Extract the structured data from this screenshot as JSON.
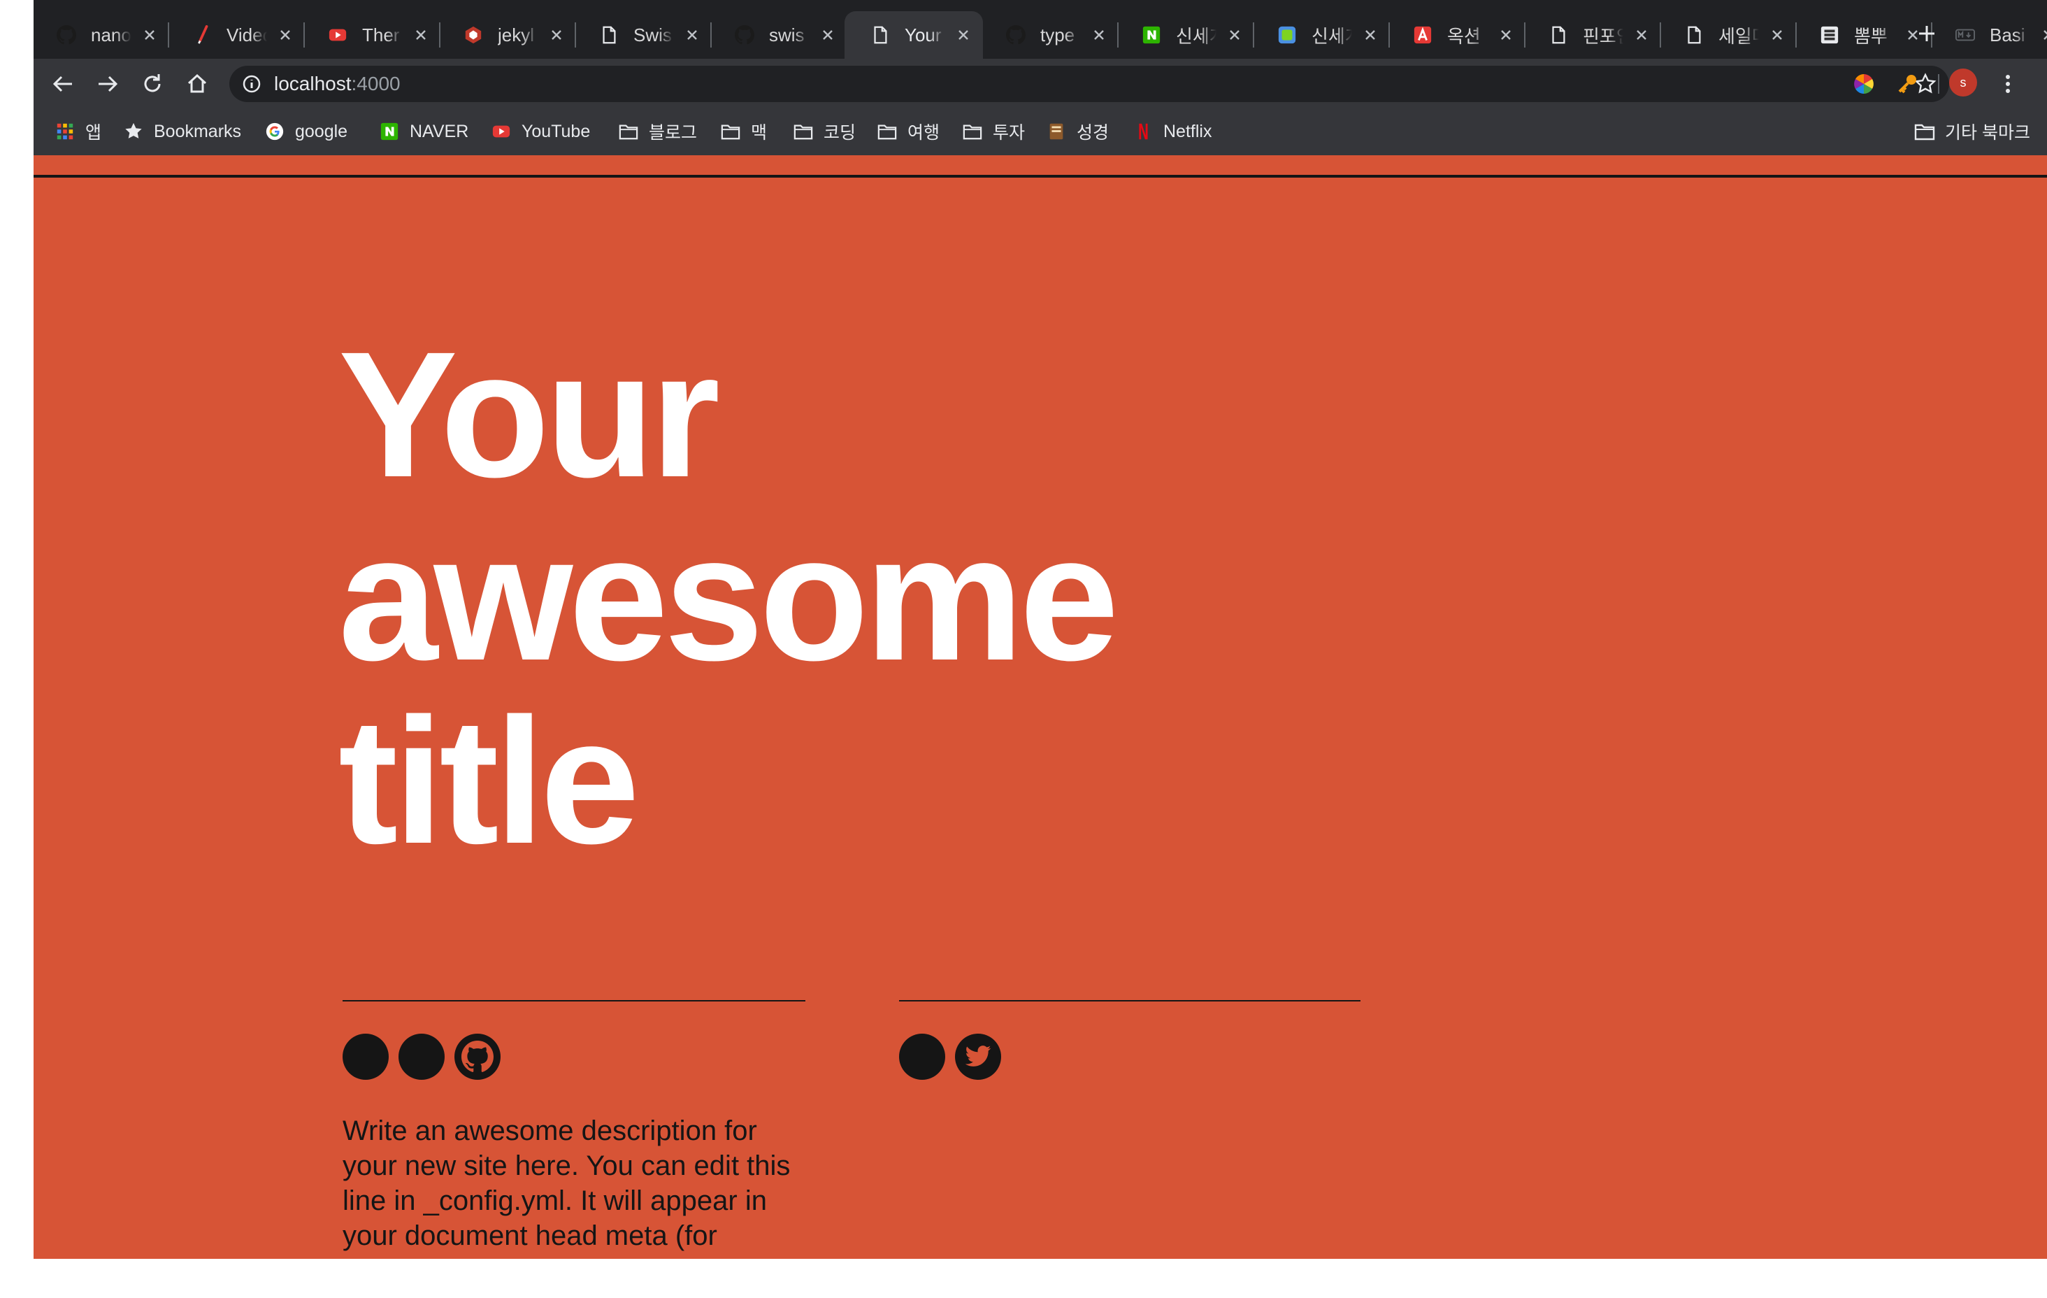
{
  "browser": {
    "tabs": [
      {
        "title": "nano",
        "icon": "github-icon"
      },
      {
        "title": "Video",
        "icon": "brush-icon"
      },
      {
        "title": "Ther",
        "icon": "youtube-icon"
      },
      {
        "title": "jekyl",
        "icon": "jekyll-icon"
      },
      {
        "title": "Swis",
        "icon": "document-icon"
      },
      {
        "title": "swis",
        "icon": "github-icon"
      },
      {
        "title": "Your",
        "icon": "document-icon",
        "active": true
      },
      {
        "title": "type",
        "icon": "github-icon"
      },
      {
        "title": "신세계",
        "icon": "naver-icon"
      },
      {
        "title": "신세계",
        "icon": "app-icon"
      },
      {
        "title": "옥션",
        "icon": "auction-icon"
      },
      {
        "title": "핀포인트",
        "icon": "document-icon"
      },
      {
        "title": "세일마",
        "icon": "document-icon"
      },
      {
        "title": "뽐뿌",
        "icon": "ppomppu-icon"
      },
      {
        "title": "Basi",
        "icon": "markdown-icon"
      }
    ],
    "address": {
      "host": "localhost",
      "port": ":4000"
    },
    "profile_initial": "s",
    "bookmarks": [
      {
        "label": "앱",
        "icon": "apps-grid-icon"
      },
      {
        "label": "Bookmarks",
        "icon": "star-icon"
      },
      {
        "label": "google",
        "icon": "google-icon"
      },
      {
        "label": "NAVER",
        "icon": "naver-icon"
      },
      {
        "label": "YouTube",
        "icon": "youtube-icon"
      },
      {
        "label": "블로그",
        "icon": "folder-icon"
      },
      {
        "label": "맥",
        "icon": "folder-icon"
      },
      {
        "label": "코딩",
        "icon": "folder-icon"
      },
      {
        "label": "여행",
        "icon": "folder-icon"
      },
      {
        "label": "투자",
        "icon": "folder-icon"
      },
      {
        "label": "성경",
        "icon": "bible-icon"
      },
      {
        "label": "Netflix",
        "icon": "netflix-icon"
      }
    ],
    "other_bookmarks": "기타 북마크"
  },
  "page": {
    "title_lines": [
      "Your",
      "awesome",
      "title"
    ],
    "description": "Write an awesome description for your new site here. You can edit this line in _config.yml. It will appear in your document head meta (for",
    "colors": {
      "background": "#d75436",
      "title": "#ffffff",
      "ink": "#151515"
    }
  }
}
